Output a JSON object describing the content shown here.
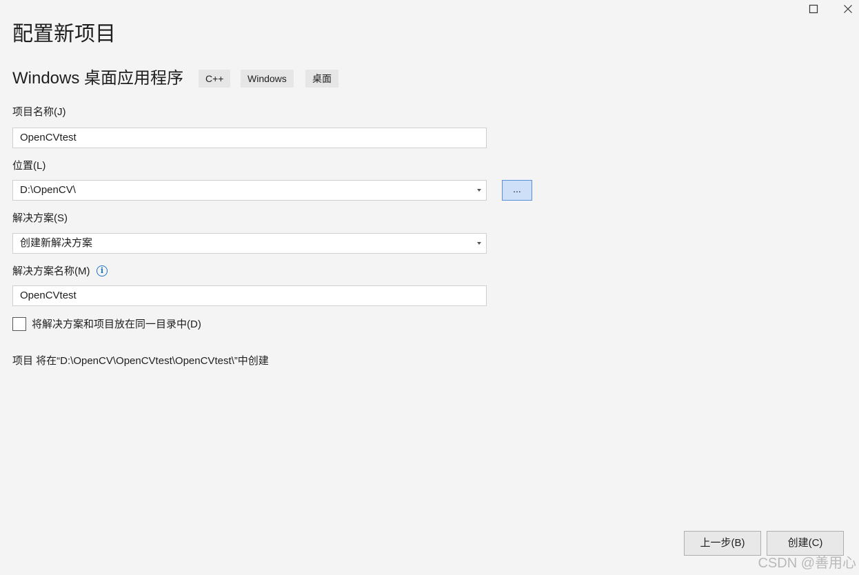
{
  "window": {
    "maximize_icon": "maximize-icon",
    "close_icon": "close-icon"
  },
  "page_title": "配置新项目",
  "template": {
    "name": "Windows 桌面应用程序",
    "tags": [
      "C++",
      "Windows",
      "桌面"
    ]
  },
  "project_name": {
    "label": "项目名称(J)",
    "value": "OpenCVtest"
  },
  "location": {
    "label": "位置(L)",
    "value": "D:\\OpenCV\\",
    "browse_label": "..."
  },
  "solution": {
    "label": "解决方案(S)",
    "value": "创建新解决方案"
  },
  "solution_name": {
    "label": "解决方案名称(M)",
    "info_glyph": "i",
    "value": "OpenCVtest"
  },
  "same_directory": {
    "label": "将解决方案和项目放在同一目录中(D)",
    "checked": false
  },
  "summary": "项目 将在“D:\\OpenCV\\OpenCVtest\\OpenCVtest\\”中创建",
  "footer": {
    "back_label": "上一步(B)",
    "create_label": "创建(C)"
  },
  "watermark": "CSDN @善用心"
}
